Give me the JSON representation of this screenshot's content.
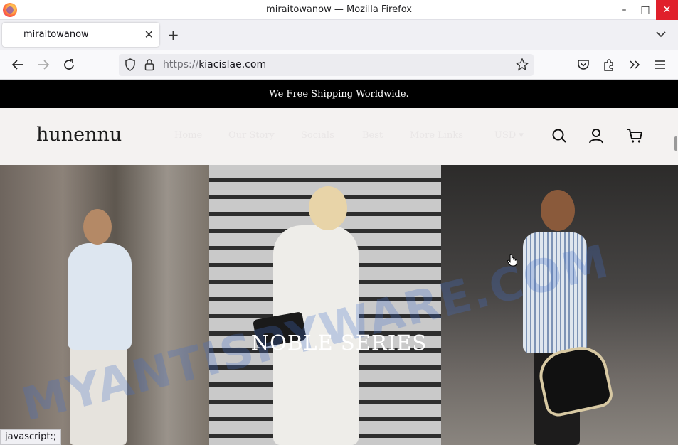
{
  "window": {
    "title": "miraitowanow — Mozilla Firefox",
    "controls": {
      "minimize": "–",
      "maximize": "□",
      "close": "✕"
    }
  },
  "tabs": [
    {
      "label": "miraitowanow",
      "active": true
    }
  ],
  "tabbar": {
    "new_tab": "+",
    "list": "⌄"
  },
  "urlbar": {
    "protocol": "https://",
    "domain": "kiacislae.com"
  },
  "page": {
    "announcement": "We Free Shipping Worldwide.",
    "logo": "hunennu",
    "menu": [
      "Home",
      "Our Story",
      "Socials",
      "Best",
      "More Links",
      "USD ▾"
    ],
    "hero_title": "NOBLE SERIES",
    "watermark": "MYANTISPYWARE.COM"
  },
  "status": "javascript:;",
  "colors": {
    "announcement_bg": "#000000",
    "header_bg": "#f4f2f1",
    "close_button": "#e0202b"
  },
  "icons": [
    "firefox-logo-icon",
    "back-icon",
    "forward-icon",
    "reload-icon",
    "shield-icon",
    "lock-icon",
    "star-icon",
    "pocket-icon",
    "extensions-icon",
    "overflow-icon",
    "menu-icon",
    "search-icon",
    "account-icon",
    "cart-icon",
    "hand-cursor-icon"
  ]
}
